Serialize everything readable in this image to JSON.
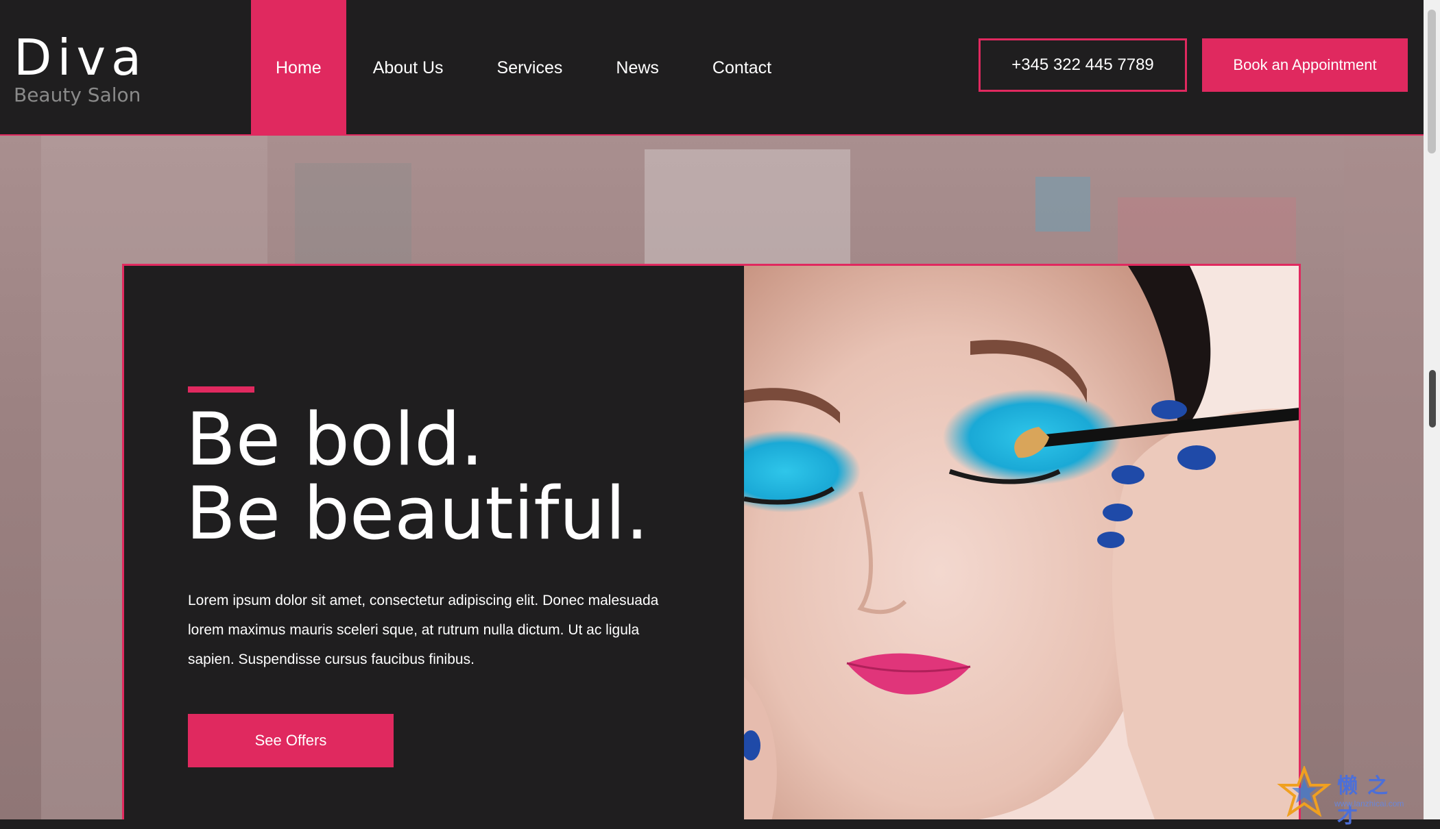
{
  "brand": {
    "name": "Diva",
    "tagline": "Beauty Salon"
  },
  "nav": {
    "items": [
      {
        "label": "Home",
        "active": true
      },
      {
        "label": "About Us",
        "active": false
      },
      {
        "label": "Services",
        "active": false
      },
      {
        "label": "News",
        "active": false
      },
      {
        "label": "Contact",
        "active": false
      }
    ]
  },
  "header": {
    "phone": "+345 322 445 7789",
    "cta_label": "Book an Appointment"
  },
  "hero": {
    "headline_line1": "Be bold.",
    "headline_line2": "Be beautiful.",
    "body": "Lorem ipsum dolor sit amet, consectetur adipiscing elit. Donec malesuada lorem maximus mauris sceleri sque, at rutrum nulla dictum. Ut ac ligula sapien. Suspendisse cursus faucibus finibus.",
    "button_label": "See Offers"
  },
  "watermark": {
    "text": "懒之才",
    "url": "www.lanzhicai.com"
  },
  "colors": {
    "accent": "#e0295f",
    "dark": "#1f1e1f",
    "text": "#ffffff"
  }
}
